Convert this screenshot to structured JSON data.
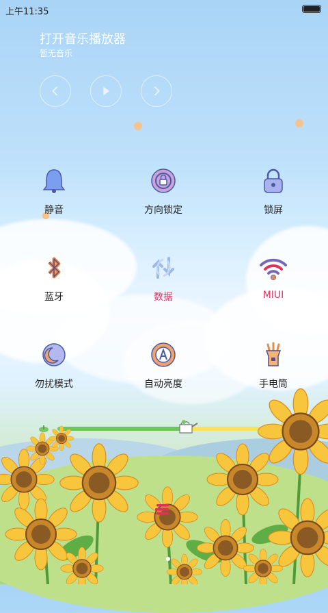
{
  "status_bar": {
    "time": "上午11:35"
  },
  "music": {
    "title": "打开音乐播放器",
    "subtitle": "暂无音乐"
  },
  "toggles": [
    {
      "label": "静音",
      "icon": "bell-icon",
      "active": false
    },
    {
      "label": "方向锁定",
      "icon": "rotation-lock-icon",
      "active": false
    },
    {
      "label": "锁屏",
      "icon": "padlock-icon",
      "active": false
    },
    {
      "label": "蓝牙",
      "icon": "bluetooth-icon",
      "active": false
    },
    {
      "label": "数据",
      "icon": "data-sync-icon",
      "active": true
    },
    {
      "label": "MIUI",
      "icon": "wifi-icon",
      "active": true
    },
    {
      "label": "勿扰模式",
      "icon": "moon-icon",
      "active": false
    },
    {
      "label": "自动亮度",
      "icon": "auto-brightness-icon",
      "active": false
    },
    {
      "label": "手电筒",
      "icon": "flashlight-icon",
      "active": false
    }
  ],
  "brightness": {
    "level": 0.62
  },
  "colors": {
    "active_label": "#e0325e",
    "icon_fill": "#6f78c8",
    "icon_accent": "#f0a36a",
    "slider_green": "#6cc75a",
    "slider_yellow": "#f7e35a"
  }
}
